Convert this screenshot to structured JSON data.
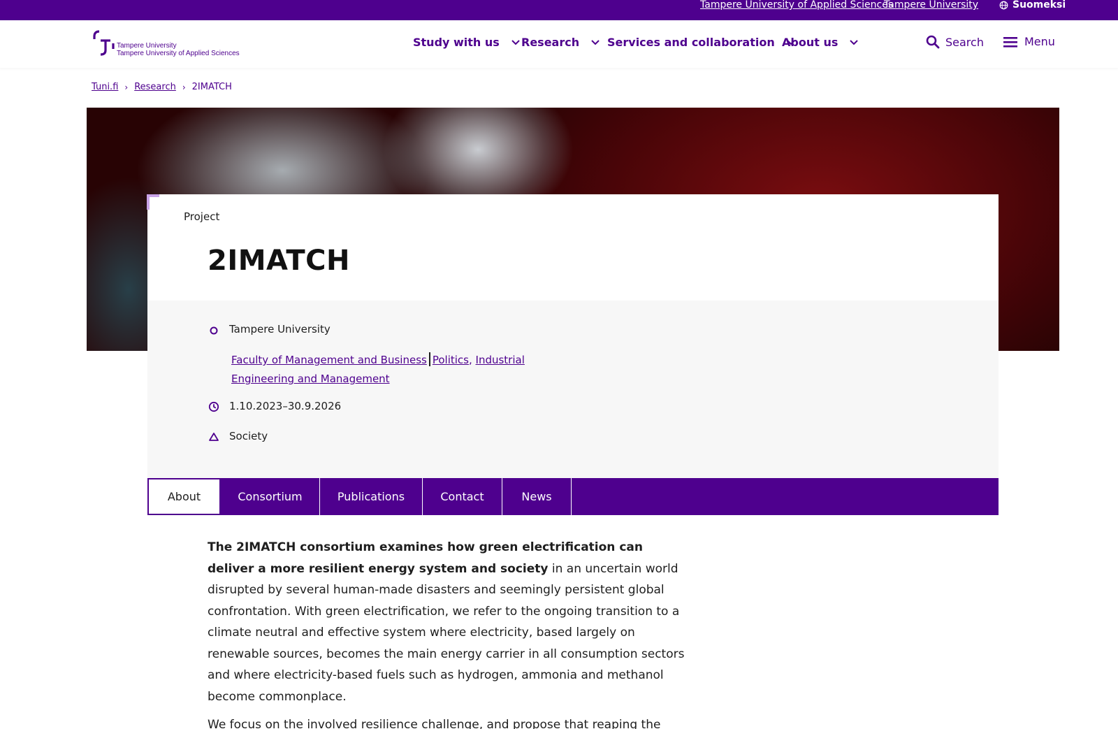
{
  "topbar": {
    "link_tamk": "Tampere University of Applied Sciences",
    "link_tuni": "Tampere University",
    "language": "Suomeksi",
    "language_icon": "globe-icon"
  },
  "header": {
    "logo_line1": "Tampere University",
    "logo_line2": "Tampere University of Applied Sciences",
    "nav": [
      "Study with us",
      "Research",
      "Services and collaboration",
      "About us"
    ],
    "search_label": "Search",
    "menu_label": "Menu"
  },
  "breadcrumb": {
    "home": "Tuni.fi",
    "section": "Research",
    "current": "2IMATCH",
    "separator": "›"
  },
  "project": {
    "kicker": "Project",
    "title": "2IMATCH",
    "organization": "Tampere University",
    "faculty_link": "Faculty of Management and Business",
    "unit_link_1": "Politics",
    "unit_link_2": "Industrial Engineering and Management",
    "dates": "1.10.2023–30.9.2026",
    "field": "Society"
  },
  "tabs": [
    "About",
    "Consortium",
    "Publications",
    "Contact",
    "News"
  ],
  "active_tab": "About",
  "content": {
    "p1_bold": "The 2IMATCH consortium examines how green electrification can deliver a more resilient energy system and society",
    "p1_rest": " in an uncertain world disrupted by several human-made disasters and seemingly persistent global confrontation. With green electrification, we refer to the ongoing transition to a climate neutral and effective system where electricity, based largely on renewable sources, becomes the main energy carrier in all consumption sectors and where electricity-based fuels such as hydrogen, ammonia and methanol become commonplace.",
    "p2": "We focus on the involved resilience challenge, and propose that reaping the benefits whilst restraining the new vulnerabilities requires new and refurbished"
  },
  "colors": {
    "brand_purple": "#4e008e",
    "accent_lilac": "#c9a3e8",
    "panel_grey": "#f7f7f7"
  }
}
